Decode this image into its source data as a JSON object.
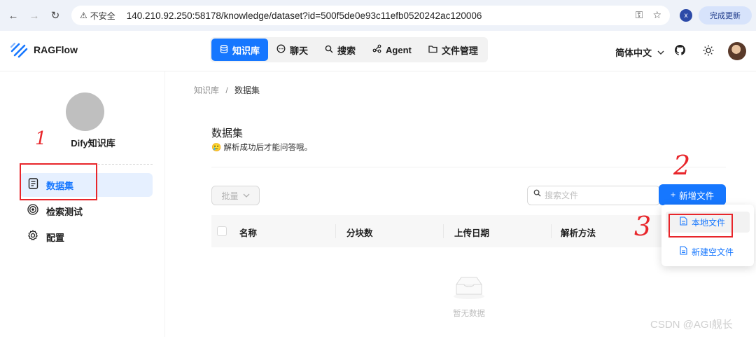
{
  "browser": {
    "insecure_label": "不安全",
    "url": "140.210.92.250:58178/knowledge/dataset?id=500f5de0e93c11efb0520242ac120006",
    "profile_initial": "x",
    "update_label": "完成更新"
  },
  "header": {
    "brand": "RAGFlow",
    "nav": [
      {
        "label": "知识库",
        "icon": "database-icon",
        "active": true
      },
      {
        "label": "聊天",
        "icon": "chat-bubble-icon",
        "active": false
      },
      {
        "label": "搜索",
        "icon": "search-icon",
        "active": false
      },
      {
        "label": "Agent",
        "icon": "graph-nodes-icon",
        "active": false
      },
      {
        "label": "文件管理",
        "icon": "folder-icon",
        "active": false
      }
    ],
    "language": "简体中文"
  },
  "sidebar": {
    "kb_name": "Dify知识库",
    "items": [
      {
        "label": "数据集",
        "icon": "document-icon",
        "active": true
      },
      {
        "label": "检索测试",
        "icon": "target-icon",
        "active": false
      },
      {
        "label": "配置",
        "icon": "gear-icon",
        "active": false
      }
    ]
  },
  "main": {
    "breadcrumb": {
      "parent": "知识库",
      "separator": "/",
      "current": "数据集"
    },
    "title": "数据集",
    "subtitle": "解析成功后才能问答哦。",
    "batch_label": "批量",
    "search_placeholder": "搜索文件",
    "add_file_label": "新增文件",
    "columns": [
      "名称",
      "分块数",
      "上传日期",
      "解析方法"
    ],
    "empty_text": "暂无数据"
  },
  "dropdown": {
    "items": [
      {
        "label": "本地文件"
      },
      {
        "label": "新建空文件"
      }
    ]
  },
  "annotations": {
    "n1": "1",
    "n2": "2",
    "n3": "3",
    "color": "#e8262b"
  },
  "watermark": "CSDN @AGI舰长",
  "colors": {
    "primary": "#1677ff",
    "active_bg": "#e6f0ff"
  }
}
